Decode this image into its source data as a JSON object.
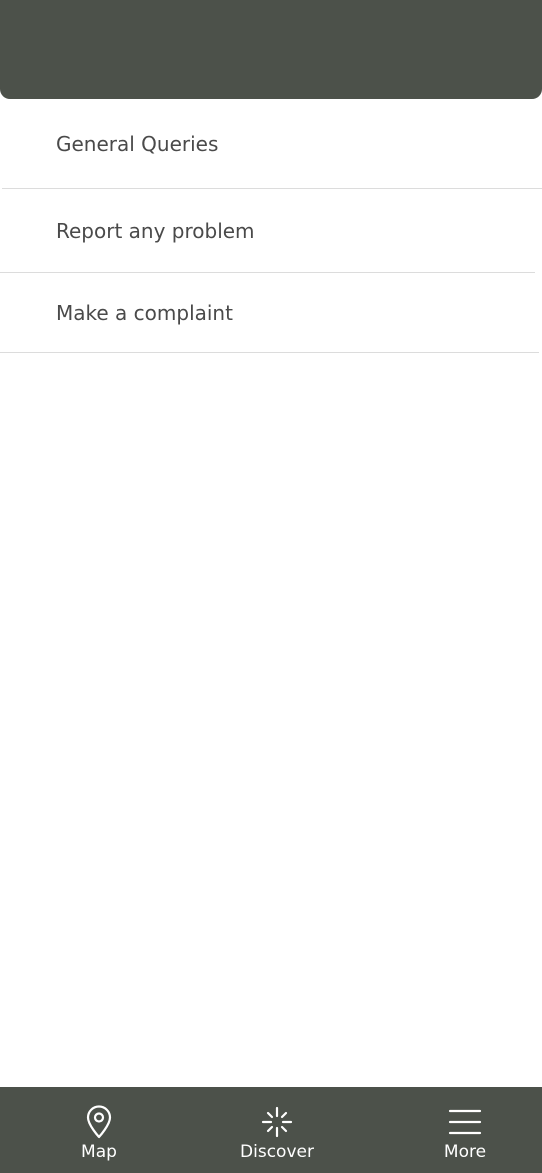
{
  "menu": {
    "items": [
      {
        "label": "General Queries"
      },
      {
        "label": "Report any problem"
      },
      {
        "label": "Make a complaint"
      }
    ]
  },
  "bottom_nav": {
    "items": [
      {
        "label": "Map",
        "icon": "map-pin-icon"
      },
      {
        "label": "Discover",
        "icon": "sparkle-icon"
      },
      {
        "label": "More",
        "icon": "hamburger-menu-icon"
      }
    ]
  },
  "colors": {
    "header_bg": "#4c514a",
    "nav_bg": "#4c514a",
    "text": "#4a4a4a",
    "nav_text": "#ffffff",
    "separator": "#dcdcdc"
  }
}
